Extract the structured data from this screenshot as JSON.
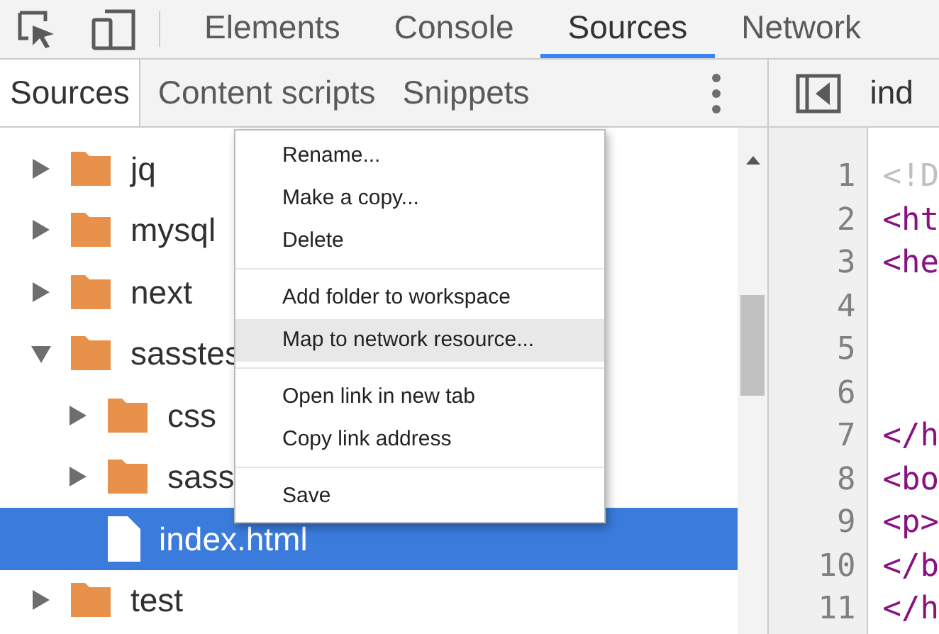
{
  "main_tabs": [
    {
      "label": "Elements",
      "selected": false
    },
    {
      "label": "Console",
      "selected": false
    },
    {
      "label": "Sources",
      "selected": true
    },
    {
      "label": "Network",
      "selected": false
    }
  ],
  "navigator_tabs": [
    {
      "label": "Sources",
      "selected": true
    },
    {
      "label": "Content scripts",
      "selected": false
    },
    {
      "label": "Snippets",
      "selected": false
    }
  ],
  "tree": [
    {
      "kind": "folder",
      "name": "jq",
      "expanded": false,
      "selected": false
    },
    {
      "kind": "folder",
      "name": "mysql",
      "expanded": false,
      "selected": false
    },
    {
      "kind": "folder",
      "name": "next",
      "expanded": false,
      "selected": false
    },
    {
      "kind": "folder",
      "name": "sasstes",
      "expanded": true,
      "selected": false,
      "children": [
        {
          "kind": "folder",
          "name": "css",
          "expanded": false,
          "selected": false
        },
        {
          "kind": "folder",
          "name": "sass",
          "expanded": false,
          "selected": false
        },
        {
          "kind": "file",
          "name": "index.html",
          "selected": true
        }
      ]
    },
    {
      "kind": "folder",
      "name": "test",
      "expanded": false,
      "selected": false
    }
  ],
  "context_menu": [
    [
      {
        "label": "Rename...",
        "selected": false
      },
      {
        "label": "Make a copy...",
        "selected": false
      },
      {
        "label": "Delete",
        "selected": false
      }
    ],
    [
      {
        "label": "Add folder to workspace",
        "selected": false
      },
      {
        "label": "Map to network resource...",
        "selected": true
      }
    ],
    [
      {
        "label": "Open link in new tab",
        "selected": false
      },
      {
        "label": "Copy link address",
        "selected": false
      }
    ],
    [
      {
        "label": "Save",
        "selected": false
      }
    ]
  ],
  "editor": {
    "tab": "ind",
    "lines": [
      {
        "number": "1",
        "code": "<!D",
        "kind": "doctype"
      },
      {
        "number": "2",
        "code": "<ht",
        "kind": "tag"
      },
      {
        "number": "3",
        "code": "<he",
        "kind": "tag"
      },
      {
        "number": "4",
        "kind": "blank"
      },
      {
        "number": "5",
        "kind": "blank"
      },
      {
        "number": "6",
        "kind": "blank"
      },
      {
        "number": "7",
        "code": "</h",
        "kind": "tag"
      },
      {
        "number": "8",
        "code": "<bo",
        "kind": "tag"
      },
      {
        "number": "9",
        "code": "<p>",
        "kind": "tag"
      },
      {
        "number": "10",
        "code": "</b",
        "kind": "tag"
      },
      {
        "number": "11",
        "code": "</h",
        "kind": "tag"
      }
    ]
  }
}
